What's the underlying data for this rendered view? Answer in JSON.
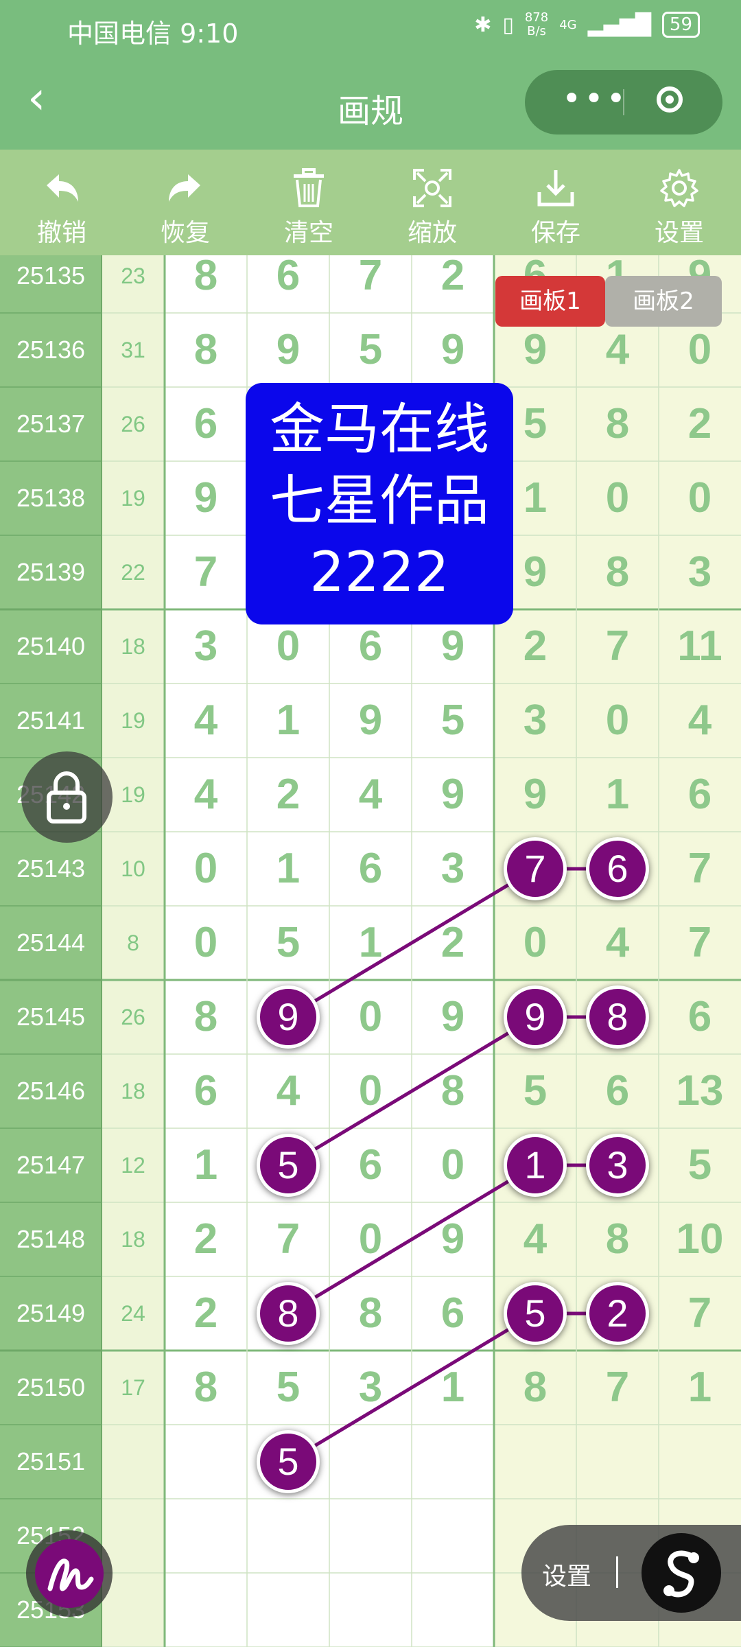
{
  "status_bar": {
    "carrier_time": "中国电信 9:10",
    "net_speed_top": "878",
    "net_speed_bottom": "B/s",
    "network": "4G",
    "battery": "59"
  },
  "title_bar": {
    "title": "画规"
  },
  "toolbar": [
    {
      "id": "undo",
      "label": "撤销",
      "icon": "undo-icon"
    },
    {
      "id": "redo",
      "label": "恢复",
      "icon": "redo-icon"
    },
    {
      "id": "clear",
      "label": "清空",
      "icon": "trash-icon"
    },
    {
      "id": "zoom",
      "label": "缩放",
      "icon": "zoom-icon"
    },
    {
      "id": "save",
      "label": "保存",
      "icon": "download-icon"
    },
    {
      "id": "settings",
      "label": "设置",
      "icon": "gear-icon"
    }
  ],
  "board_tabs": [
    "画板1",
    "画板2"
  ],
  "active_board_tab": 0,
  "watermark": {
    "line1": "金马在线",
    "line2": "七星作品",
    "line3": "2222"
  },
  "rows": [
    {
      "issue": "25135",
      "sum": "23",
      "digits": [
        "8",
        "6",
        "7",
        "2",
        "6",
        "1",
        "9"
      ]
    },
    {
      "issue": "25136",
      "sum": "31",
      "digits": [
        "8",
        "9",
        "5",
        "9",
        "9",
        "4",
        "0"
      ]
    },
    {
      "issue": "25137",
      "sum": "26",
      "digits": [
        "6",
        "",
        "",
        "",
        "5",
        "8",
        "2"
      ]
    },
    {
      "issue": "25138",
      "sum": "19",
      "digits": [
        "9",
        "",
        "",
        "",
        "1",
        "0",
        "0"
      ]
    },
    {
      "issue": "25139",
      "sum": "22",
      "digits": [
        "7",
        "",
        "",
        "",
        "9",
        "8",
        "3"
      ]
    },
    {
      "issue": "25140",
      "sum": "18",
      "digits": [
        "3",
        "0",
        "6",
        "9",
        "2",
        "7",
        "11"
      ]
    },
    {
      "issue": "25141",
      "sum": "19",
      "digits": [
        "4",
        "1",
        "9",
        "5",
        "3",
        "0",
        "4"
      ]
    },
    {
      "issue": "25142",
      "sum": "19",
      "digits": [
        "4",
        "2",
        "4",
        "9",
        "9",
        "1",
        "6"
      ]
    },
    {
      "issue": "25143",
      "sum": "10",
      "digits": [
        "0",
        "1",
        "6",
        "3",
        "7",
        "6",
        "7"
      ]
    },
    {
      "issue": "25144",
      "sum": "8",
      "digits": [
        "0",
        "5",
        "1",
        "2",
        "0",
        "4",
        "7"
      ]
    },
    {
      "issue": "25145",
      "sum": "26",
      "digits": [
        "8",
        "9",
        "0",
        "9",
        "9",
        "8",
        "6"
      ]
    },
    {
      "issue": "25146",
      "sum": "18",
      "digits": [
        "6",
        "4",
        "0",
        "8",
        "5",
        "6",
        "13"
      ]
    },
    {
      "issue": "25147",
      "sum": "12",
      "digits": [
        "1",
        "5",
        "6",
        "0",
        "1",
        "3",
        "5"
      ]
    },
    {
      "issue": "25148",
      "sum": "18",
      "digits": [
        "2",
        "7",
        "0",
        "9",
        "4",
        "8",
        "10"
      ]
    },
    {
      "issue": "25149",
      "sum": "24",
      "digits": [
        "2",
        "8",
        "8",
        "6",
        "5",
        "2",
        "7"
      ]
    },
    {
      "issue": "25150",
      "sum": "17",
      "digits": [
        "8",
        "5",
        "3",
        "1",
        "8",
        "7",
        "1"
      ]
    },
    {
      "issue": "25151",
      "sum": "",
      "digits": [
        "",
        "5",
        "",
        "",
        "",
        "",
        ""
      ]
    },
    {
      "issue": "25152",
      "sum": "",
      "digits": [
        "",
        "",
        "",
        "",
        "",
        "",
        ""
      ]
    },
    {
      "issue": "25153",
      "sum": "",
      "digits": [
        "",
        "",
        "",
        "",
        "",
        "",
        ""
      ]
    }
  ],
  "marks": [
    {
      "row": 8,
      "col": 4
    },
    {
      "row": 8,
      "col": 5
    },
    {
      "row": 10,
      "col": 1
    },
    {
      "row": 10,
      "col": 4
    },
    {
      "row": 10,
      "col": 5
    },
    {
      "row": 12,
      "col": 1
    },
    {
      "row": 12,
      "col": 4
    },
    {
      "row": 12,
      "col": 5
    },
    {
      "row": 14,
      "col": 1
    },
    {
      "row": 14,
      "col": 4
    },
    {
      "row": 14,
      "col": 5
    },
    {
      "row": 16,
      "col": 1
    }
  ],
  "links": [
    [
      [
        8,
        4
      ],
      [
        8,
        5
      ]
    ],
    [
      [
        10,
        1
      ],
      [
        8,
        4
      ]
    ],
    [
      [
        10,
        4
      ],
      [
        10,
        5
      ]
    ],
    [
      [
        12,
        1
      ],
      [
        10,
        4
      ]
    ],
    [
      [
        12,
        4
      ],
      [
        12,
        5
      ]
    ],
    [
      [
        14,
        1
      ],
      [
        12,
        4
      ]
    ],
    [
      [
        14,
        4
      ],
      [
        14,
        5
      ]
    ],
    [
      [
        16,
        1
      ],
      [
        14,
        4
      ]
    ]
  ],
  "floating": {
    "settings_label": "设置"
  },
  "colors": {
    "header": "#79bd7e",
    "toolbar": "#a4ce8e",
    "issue_col": "#8fc484",
    "sum_col": "#eef5d8",
    "right_zone": "#f4f8dc",
    "digit": "#8ec88b",
    "mark": "#7a0a78",
    "tab_active": "#d43838",
    "watermark": "#0b07eb"
  }
}
